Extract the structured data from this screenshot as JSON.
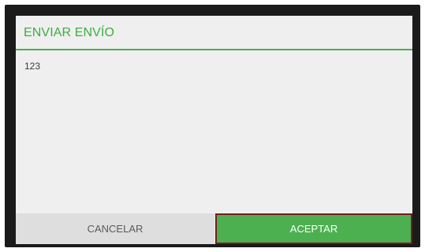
{
  "dialog": {
    "title": "ENVIAR ENVÍO",
    "message": "123",
    "cancel_label": "CANCELAR",
    "accept_label": "ACEPTAR"
  },
  "colors": {
    "accent": "#4cb050",
    "title_text": "#3eac43",
    "focus_border": "#7a1c1c",
    "cancel_bg": "#dedede",
    "dialog_bg": "#efefef",
    "frame_bg": "#1a1a1a"
  }
}
